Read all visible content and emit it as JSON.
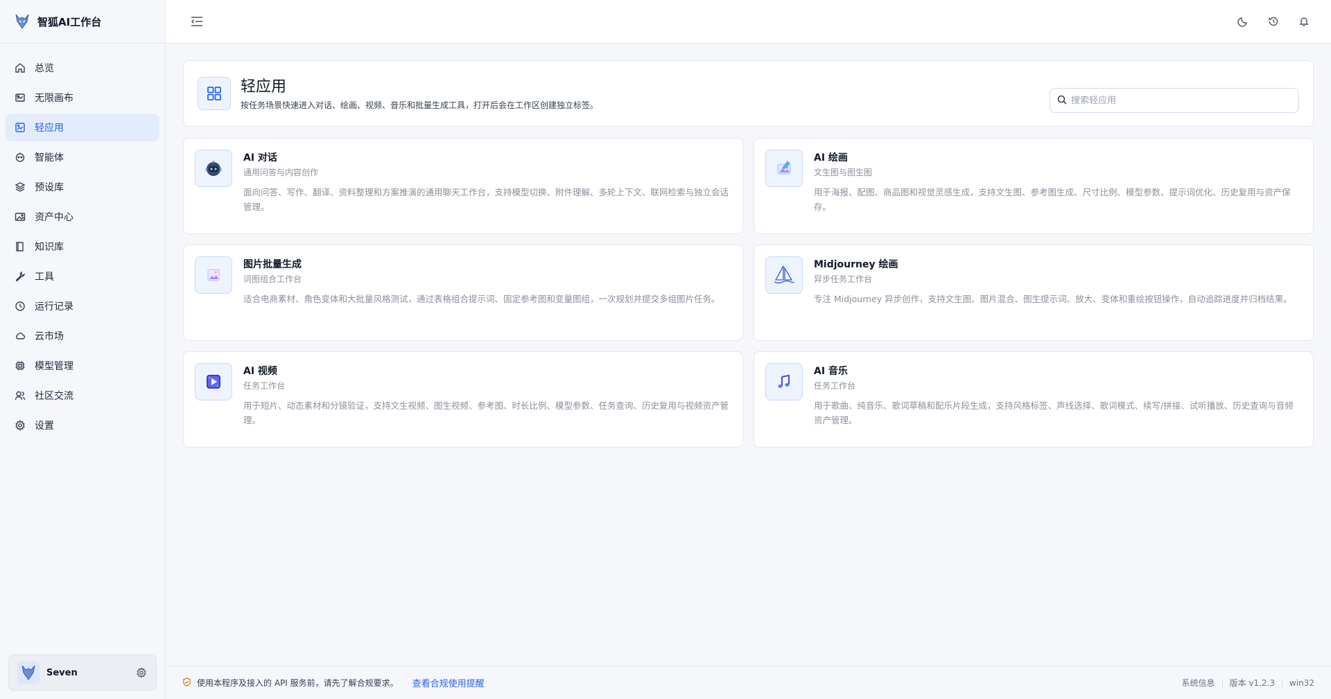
{
  "app": {
    "title": "智狐AI工作台"
  },
  "sidebar": {
    "items": [
      {
        "label": "总览",
        "icon": "home-icon"
      },
      {
        "label": "无限画布",
        "icon": "canvas-icon"
      },
      {
        "label": "轻应用",
        "icon": "image-app-icon",
        "active": true
      },
      {
        "label": "智能体",
        "icon": "agent-icon"
      },
      {
        "label": "预设库",
        "icon": "layers-icon"
      },
      {
        "label": "资产中心",
        "icon": "picture-icon"
      },
      {
        "label": "知识库",
        "icon": "book-icon"
      },
      {
        "label": "工具",
        "icon": "wrench-icon"
      },
      {
        "label": "运行记录",
        "icon": "clock-icon"
      },
      {
        "label": "云市场",
        "icon": "cloud-icon"
      },
      {
        "label": "模型管理",
        "icon": "chip-icon"
      },
      {
        "label": "社区交流",
        "icon": "users-icon"
      },
      {
        "label": "设置",
        "icon": "gear-icon"
      }
    ],
    "user": {
      "name": "Seven"
    }
  },
  "page": {
    "title": "轻应用",
    "description": "按任务场景快速进入对话、绘画、视频、音乐和批量生成工具，打开后会在工作区创建独立标签。",
    "search_placeholder": "搜索轻应用"
  },
  "apps": [
    {
      "name": "AI 对话",
      "subtitle": "通用问答与内容创作",
      "description": "面向问答、写作、翻译、资料整理和方案推演的通用聊天工作台，支持模型切换、附件理解、多轮上下文、联网检索与独立会话管理。",
      "icon": "robot-icon"
    },
    {
      "name": "AI 绘画",
      "subtitle": "文生图与图生图",
      "description": "用于海报、配图、商品图和视觉灵感生成，支持文生图、参考图生成、尺寸比例、模型参数、提示词优化、历史复用与资产保存。",
      "icon": "paint-icon"
    },
    {
      "name": "图片批量生成",
      "subtitle": "词图组合工作台",
      "description": "适合电商素材、角色变体和大批量风格测试，通过表格组合提示词、固定参考图和变量图组，一次规划并提交多组图片任务。",
      "icon": "gallery-icon"
    },
    {
      "name": "Midjourney 绘画",
      "subtitle": "异步任务工作台",
      "description": "专注 Midjourney 异步创作，支持文生图、图片混合、图生提示词、放大、变体和重绘按钮操作，自动追踪进度并归档结果。",
      "icon": "sailboat-icon"
    },
    {
      "name": "AI 视频",
      "subtitle": "任务工作台",
      "description": "用于短片、动态素材和分镜验证，支持文生视频、图生视频、参考图、时长比例、模型参数、任务查询、历史复用与视频资产管理。",
      "icon": "video-icon"
    },
    {
      "name": "AI 音乐",
      "subtitle": "任务工作台",
      "description": "用于歌曲、纯音乐、歌词草稿和配乐片段生成，支持风格标签、声线选择、歌词模式、续写/拼接、试听播放、历史查询与音频资产管理。",
      "icon": "music-note-icon"
    }
  ],
  "footer": {
    "notice": "使用本程序及接入的 API 服务前，请先了解合规要求。",
    "link": "查看合规使用提醒",
    "system_info": "系统信息",
    "version": "版本 v1.2.3",
    "platform": "win32"
  }
}
